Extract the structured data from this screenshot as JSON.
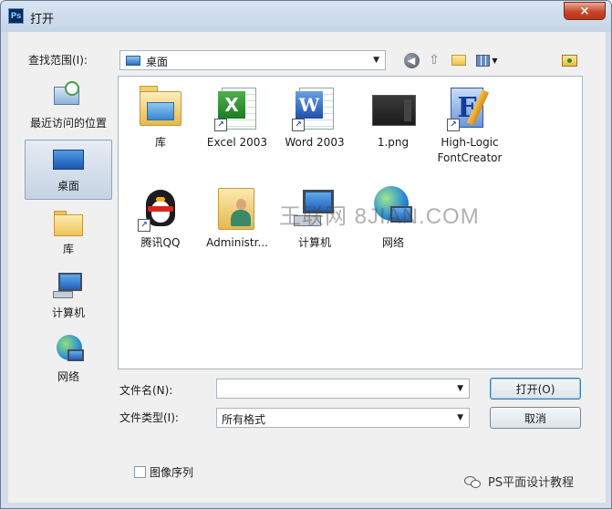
{
  "window": {
    "app_icon": "Ps",
    "title": "打开",
    "close_glyph": "×"
  },
  "toolbar": {
    "look_in_label": "查找范围(I):",
    "look_in_value": "桌面",
    "icons": [
      "back-icon",
      "up-folder-icon",
      "new-folder-icon",
      "view-menu-icon",
      "folder-preview-icon"
    ]
  },
  "places": [
    {
      "label": "最近访问的位置",
      "icon": "recent-places-icon",
      "selected": false
    },
    {
      "label": "桌面",
      "icon": "desktop-icon",
      "selected": true
    },
    {
      "label": "库",
      "icon": "libraries-icon",
      "selected": false
    },
    {
      "label": "计算机",
      "icon": "computer-icon",
      "selected": false
    },
    {
      "label": "网络",
      "icon": "network-icon",
      "selected": false
    }
  ],
  "files": [
    {
      "label": "库",
      "icon": "libraries-folder-icon"
    },
    {
      "label": "Excel 2003",
      "icon": "excel-shortcut-icon"
    },
    {
      "label": "Word 2003",
      "icon": "word-shortcut-icon"
    },
    {
      "label": "1.png",
      "icon": "png-file-icon"
    },
    {
      "label": "High-Logic",
      "label2": "FontCreator",
      "icon": "fontcreator-shortcut-icon"
    },
    {
      "label": "腾讯QQ",
      "icon": "qq-shortcut-icon"
    },
    {
      "label": "Administr...",
      "icon": "user-folder-icon"
    },
    {
      "label": "计算机",
      "icon": "computer-icon"
    },
    {
      "label": "网络",
      "icon": "network-icon"
    }
  ],
  "watermark": "王联网 8JIAN.COM",
  "form": {
    "filename_label": "文件名(N):",
    "filename_value": "",
    "filetype_label": "文件类型(I):",
    "filetype_value": "所有格式",
    "open_button": "打开(O)",
    "cancel_button": "取消",
    "image_sequence_label": "图像序列",
    "image_sequence_checked": false
  },
  "branding": {
    "icon": "wechat-icon",
    "text": "PS平面设计教程"
  },
  "colors": {
    "titlebar": "#c5d4e7",
    "close_button": "#c9462a",
    "selection": "#c5d3e4"
  }
}
